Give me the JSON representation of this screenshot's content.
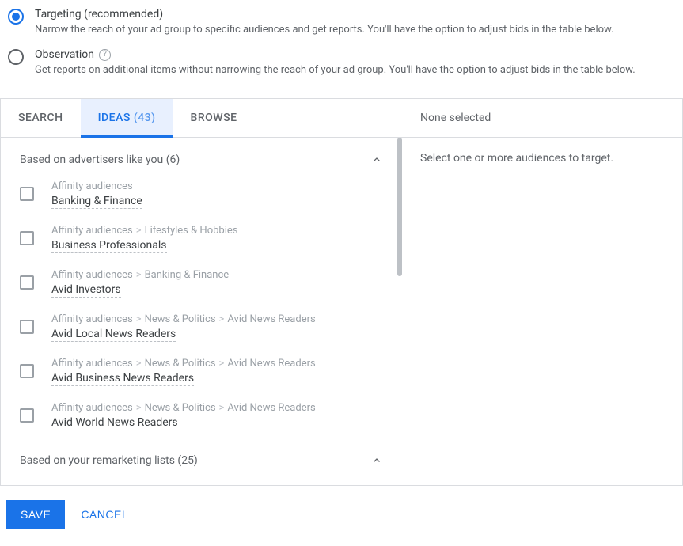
{
  "options": {
    "targeting": {
      "title": "Targeting (recommended)",
      "desc": "Narrow the reach of your ad group to specific audiences and get reports. You'll have the option to adjust bids in the table below."
    },
    "observation": {
      "title": "Observation",
      "desc": "Get reports on additional items without narrowing the reach of your ad group. You'll have the option to adjust bids in the table below."
    }
  },
  "tabs": {
    "search": "Search",
    "ideas": "Ideas",
    "ideas_count": "(43)",
    "browse": "Browse"
  },
  "right": {
    "header": "None selected",
    "body": "Select one or more audiences to target."
  },
  "sections": {
    "advertisers": {
      "label": "Based on advertisers like you (6)"
    },
    "remarketing": {
      "label": "Based on your remarketing lists (25)"
    }
  },
  "bc": {
    "affinity": "Affinity audiences",
    "lifestyles": "Lifestyles & Hobbies",
    "banking": "Banking & Finance",
    "news": "News & Politics",
    "avid_readers": "Avid News Readers"
  },
  "items": [
    {
      "name": "Banking & Finance"
    },
    {
      "name": "Business Professionals"
    },
    {
      "name": "Avid Investors"
    },
    {
      "name": "Avid Local News Readers"
    },
    {
      "name": "Avid Business News Readers"
    },
    {
      "name": "Avid World News Readers"
    }
  ],
  "footer": {
    "save": "SAVE",
    "cancel": "CANCEL"
  }
}
